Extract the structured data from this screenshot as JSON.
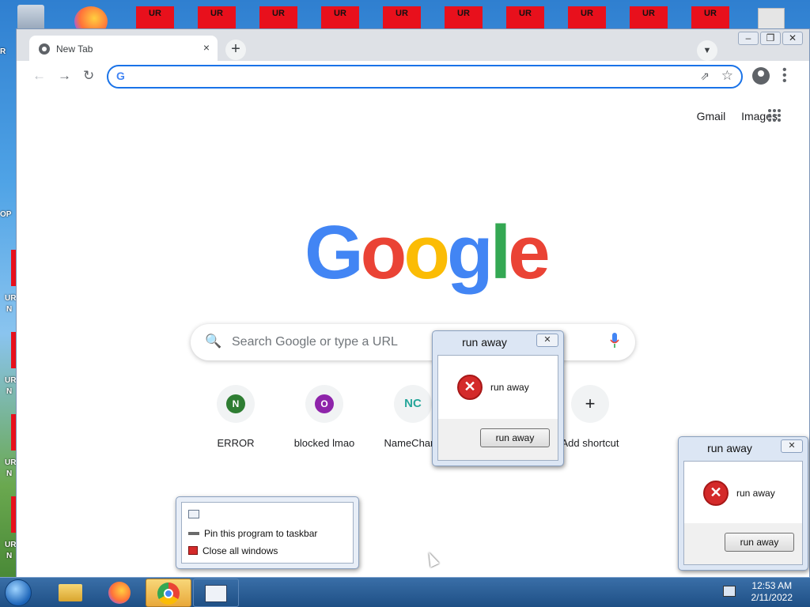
{
  "desktop": {
    "ur_icons": [
      {
        "label": "UR"
      },
      {
        "label": "UR"
      },
      {
        "label": "UR"
      },
      {
        "label": "UR"
      },
      {
        "label": "UR"
      },
      {
        "label": "UR"
      },
      {
        "label": "UR"
      },
      {
        "label": "UR"
      },
      {
        "label": "UR"
      },
      {
        "label": "UR"
      }
    ],
    "left_fragments": [
      "R",
      "OP",
      "UR",
      "N",
      "UR",
      "N",
      "UR",
      "N",
      "UR",
      "N"
    ]
  },
  "browser": {
    "tab_title": "New Tab",
    "tab_close": "×",
    "new_tab": "+",
    "omnibox_value": "",
    "top_links": {
      "gmail": "Gmail",
      "images": "Images"
    },
    "logo_letters": [
      {
        "ch": "G",
        "color": "#4285f4"
      },
      {
        "ch": "o",
        "color": "#ea4335"
      },
      {
        "ch": "o",
        "color": "#fbbc05"
      },
      {
        "ch": "g",
        "color": "#4285f4"
      },
      {
        "ch": "l",
        "color": "#34a853"
      },
      {
        "ch": "e",
        "color": "#ea4335"
      }
    ],
    "search_placeholder": "Search Google or type a URL",
    "shortcuts": [
      {
        "label": "ERROR",
        "initial": "N",
        "color": "#2e7d32"
      },
      {
        "label": "blocked lmao",
        "initial": "O",
        "color": "#8e24aa"
      },
      {
        "label": "NameChang",
        "initial": "NC",
        "color": "#26a69a"
      },
      {
        "label": "Add shortcut",
        "initial": "+",
        "color": "#202124"
      }
    ]
  },
  "dialogs": [
    {
      "title": "run away",
      "message": "run away",
      "button": "run away"
    },
    {
      "title": "run away",
      "message": "run away",
      "button": "run away"
    }
  ],
  "jumplist": {
    "items": [
      "Pin this program to taskbar",
      "Close all windows"
    ]
  },
  "taskbar": {
    "time": "12:53 AM",
    "date": "2/11/2022"
  }
}
